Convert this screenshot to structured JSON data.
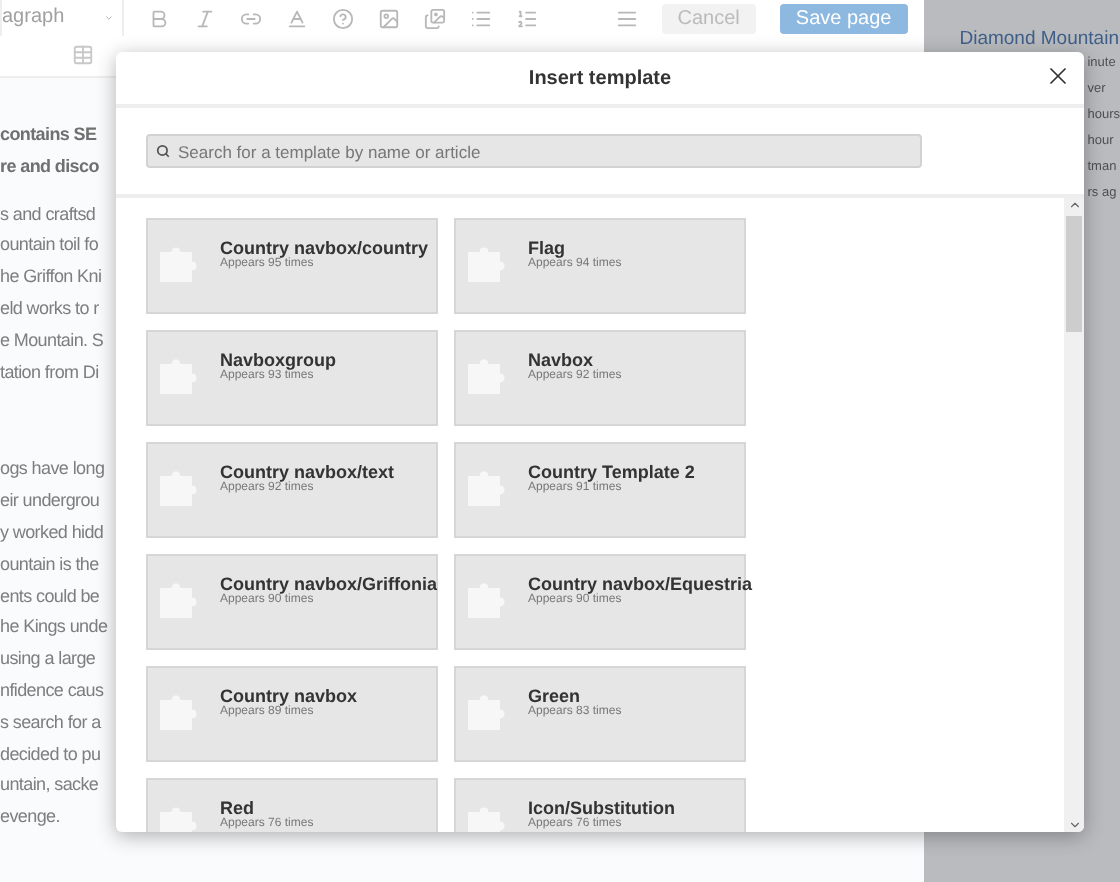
{
  "toolbar": {
    "format": "agraph",
    "cancel": "Cancel",
    "save": "Save page"
  },
  "editor": {
    "heading": [
      "contains SE",
      "re and disco"
    ],
    "paragraphs": [
      [
        "s and craftsd",
        "ountain toil fo",
        "he Griffon Kni",
        "eld works to r",
        "e Mountain. S",
        "tation from Di"
      ],
      [
        "ogs have long",
        "eir undergrou",
        "y worked hidd",
        "ountain is the",
        "ents could be",
        "he Kings unde",
        "using a large",
        "nfidence caus",
        "s search for a",
        "decided to pu",
        "untain, sacke",
        "evenge."
      ]
    ]
  },
  "sidebar": {
    "link": "Diamond Mountain",
    "fragments": [
      "inute",
      "ver",
      "hours",
      "hour",
      "tman",
      "rs ag"
    ]
  },
  "dialog": {
    "title": "Insert template",
    "search": {
      "placeholder": "Search for a template by name or article"
    },
    "templates": [
      {
        "name": "Country navbox/country",
        "count": "Appears 95 times"
      },
      {
        "name": "Flag",
        "count": "Appears 94 times"
      },
      {
        "name": "Navboxgroup",
        "count": "Appears 93 times"
      },
      {
        "name": "Navbox",
        "count": "Appears 92 times"
      },
      {
        "name": "Country navbox/text",
        "count": "Appears 92 times"
      },
      {
        "name": "Country Template 2",
        "count": "Appears 91 times"
      },
      {
        "name": "Country navbox/Griffonia",
        "count": "Appears 90 times"
      },
      {
        "name": "Country navbox/Equestria",
        "count": "Appears 90 times"
      },
      {
        "name": "Country navbox",
        "count": "Appears 89 times"
      },
      {
        "name": "Green",
        "count": "Appears 83 times"
      },
      {
        "name": "Red",
        "count": "Appears 76 times"
      },
      {
        "name": "Icon/Substitution",
        "count": "Appears 76 times"
      }
    ]
  }
}
